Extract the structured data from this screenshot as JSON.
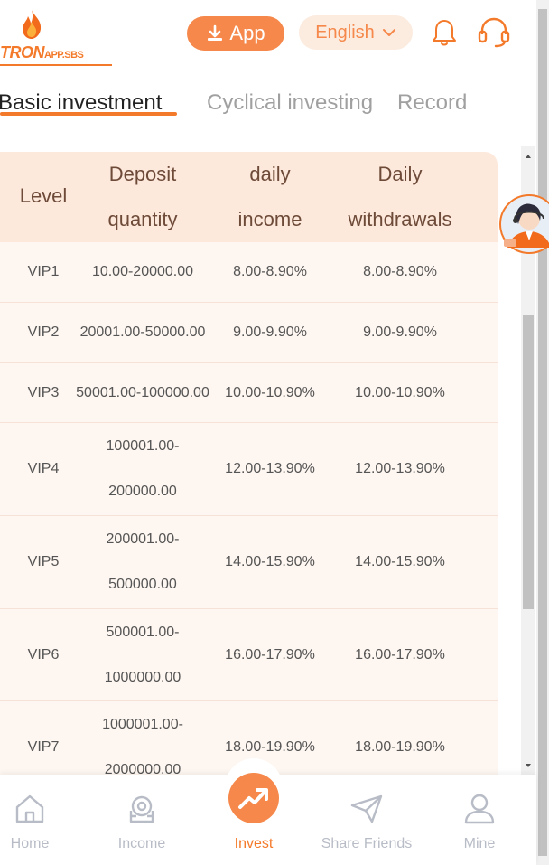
{
  "header": {
    "logo_brand": "TRON",
    "logo_domain": "APP.SBS",
    "app_button_label": "App",
    "language_button_label": "English",
    "icons": [
      "download-icon",
      "chevron-down-icon",
      "bell-icon",
      "headset-icon"
    ]
  },
  "tabs": [
    {
      "label": "Basic investment",
      "active": true
    },
    {
      "label": "Cyclical investing",
      "active": false
    },
    {
      "label": "Record",
      "active": false
    }
  ],
  "table": {
    "headers": {
      "level": "Level",
      "deposit_line1": "Deposit",
      "deposit_line2": "quantity",
      "income_line1": "daily",
      "income_line2": "income",
      "withdraw_line1": "Daily",
      "withdraw_line2": "withdrawals"
    },
    "rows": [
      {
        "level": "VIP1",
        "deposit_a": "10.00-20000.00",
        "deposit_b": "",
        "income": "8.00-8.90%",
        "withdraw": "8.00-8.90%"
      },
      {
        "level": "VIP2",
        "deposit_a": "20001.00-50000.00",
        "deposit_b": "",
        "income": "9.00-9.90%",
        "withdraw": "9.00-9.90%"
      },
      {
        "level": "VIP3",
        "deposit_a": "50001.00-100000.00",
        "deposit_b": "",
        "income": "10.00-10.90%",
        "withdraw": "10.00-10.90%"
      },
      {
        "level": "VIP4",
        "deposit_a": "100001.00-",
        "deposit_b": "200000.00",
        "income": "12.00-13.90%",
        "withdraw": "12.00-13.90%"
      },
      {
        "level": "VIP5",
        "deposit_a": "200001.00-",
        "deposit_b": "500000.00",
        "income": "14.00-15.90%",
        "withdraw": "14.00-15.90%"
      },
      {
        "level": "VIP6",
        "deposit_a": "500001.00-",
        "deposit_b": "1000000.00",
        "income": "16.00-17.90%",
        "withdraw": "16.00-17.90%"
      },
      {
        "level": "VIP7",
        "deposit_a": "1000001.00-",
        "deposit_b": "2000000.00",
        "income": "18.00-19.90%",
        "withdraw": "18.00-19.90%"
      }
    ]
  },
  "bottom_nav": [
    {
      "label": "Home",
      "icon": "home-icon",
      "active": false
    },
    {
      "label": "Income",
      "icon": "income-icon",
      "active": false
    },
    {
      "label": "Invest",
      "icon": "invest-trend-icon",
      "active": true
    },
    {
      "label": "Share Friends",
      "icon": "paper-plane-icon",
      "active": false
    },
    {
      "label": "Mine",
      "icon": "user-icon",
      "active": false
    }
  ],
  "colors": {
    "accent": "#f47a2b",
    "accent_light": "#fcebdf",
    "table_header_bg": "#fde9dc",
    "table_body_bg": "#fef6f0",
    "inactive_text": "#b8bcc6"
  }
}
